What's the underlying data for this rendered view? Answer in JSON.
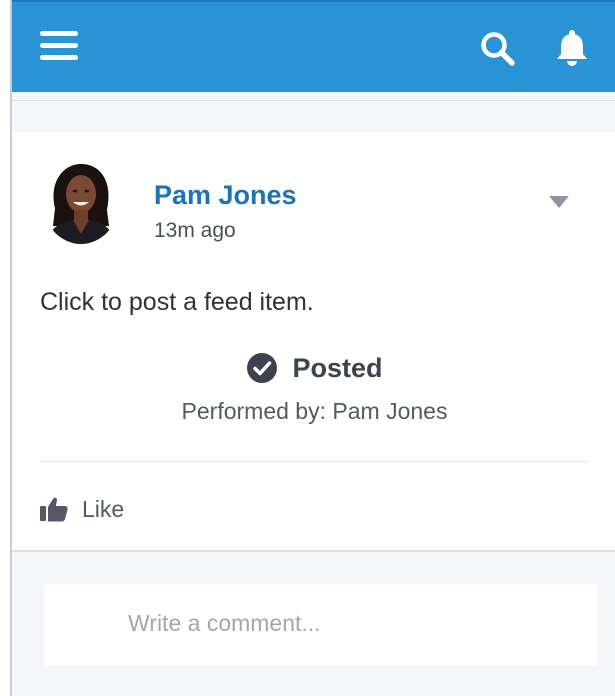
{
  "header": {
    "menu_icon": "hamburger-menu-icon",
    "search_icon": "search-icon",
    "notifications_icon": "bell-icon",
    "background_color": "#2a93d5"
  },
  "feed_item": {
    "author": "Pam Jones",
    "timestamp": "13m ago",
    "body": "Click to post a feed item.",
    "status": {
      "icon": "check-circle-icon",
      "label": "Posted"
    },
    "performed_by": "Performed by: Pam Jones",
    "actions": {
      "like_label": "Like",
      "like_icon": "thumbs-up-icon"
    },
    "menu_icon": "caret-down-icon",
    "author_link_color": "#1b73b8"
  },
  "comment": {
    "placeholder": "Write a comment..."
  }
}
